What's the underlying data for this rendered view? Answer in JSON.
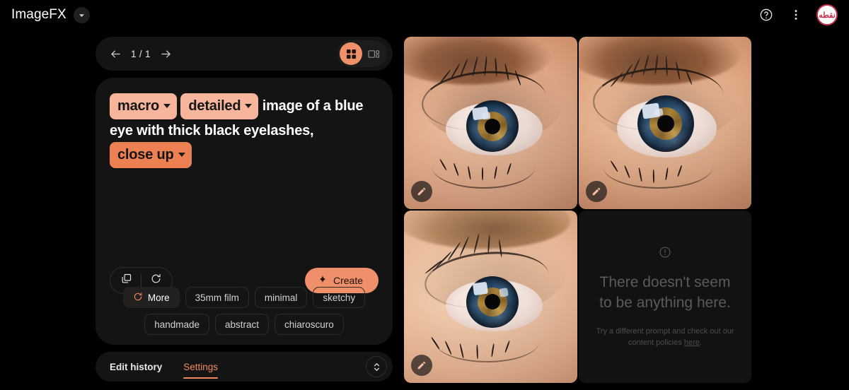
{
  "header": {
    "brand": "ImageFX",
    "brand_caret_icon": "chevron-down-icon",
    "help_icon": "help-circle-icon",
    "more_icon": "more-vertical-icon",
    "avatar_label": "نقطه",
    "avatar_name": "user-avatar"
  },
  "pager": {
    "prev_icon": "arrow-left-icon",
    "next_icon": "arrow-right-icon",
    "count": "1 / 1",
    "views": [
      {
        "name": "grid-view",
        "icon": "grid-2x2-icon",
        "selected": true
      },
      {
        "name": "detail-view",
        "icon": "detail-layout-icon",
        "selected": false
      }
    ]
  },
  "prompt": {
    "segments": [
      {
        "type": "chip",
        "text": "macro",
        "style": "light"
      },
      {
        "type": "chip",
        "text": "detailed",
        "style": "light"
      },
      {
        "type": "text",
        "text": "image of a blue eye with thick black eyelashes,"
      },
      {
        "type": "chip",
        "text": "close up",
        "style": "deep"
      }
    ],
    "full_text": "macro detailed image of a blue eye with thick black eyelashes, close up",
    "copy_icon": "copy-icon",
    "reset_icon": "reset-icon",
    "create_label": "Create",
    "create_icon": "sparkle-icon"
  },
  "suggestions": [
    {
      "label": "More",
      "icon": "refresh-icon",
      "filled": true
    },
    {
      "label": "35mm film",
      "filled": false
    },
    {
      "label": "minimal",
      "filled": false
    },
    {
      "label": "sketchy",
      "filled": false
    },
    {
      "label": "handmade",
      "filled": false
    },
    {
      "label": "abstract",
      "filled": false
    },
    {
      "label": "chiaroscuro",
      "filled": false
    }
  ],
  "bottom_bar": {
    "tabs": [
      {
        "label": "Edit history",
        "active": false
      },
      {
        "label": "Settings",
        "active": true
      }
    ],
    "expand_icon": "chevron-up-down-icon"
  },
  "results": {
    "tiles": [
      {
        "name": "result-image-1",
        "alt": "macro photo of blue eye with long eyelashes",
        "edit_icon": "edit-pencil-icon"
      },
      {
        "name": "result-image-2",
        "alt": "macro photo of blue eye looking forward",
        "edit_icon": "edit-pencil-icon"
      },
      {
        "name": "result-image-3",
        "alt": "macro photo of blue eye, close up",
        "edit_icon": "edit-pencil-icon"
      }
    ],
    "empty": {
      "icon": "alert-circle-icon",
      "heading": "There doesn't seem to be anything here.",
      "sub_before": "Try a different prompt and check out our content policies ",
      "sub_link": "here",
      "sub_after": "."
    }
  },
  "colors": {
    "accent": "#f0906b",
    "chip_light": "#f7b69c",
    "chip_deep": "#ed8053",
    "page_bg": "#000000",
    "card_bg": "#141414",
    "avatar_red": "#c4304a"
  }
}
